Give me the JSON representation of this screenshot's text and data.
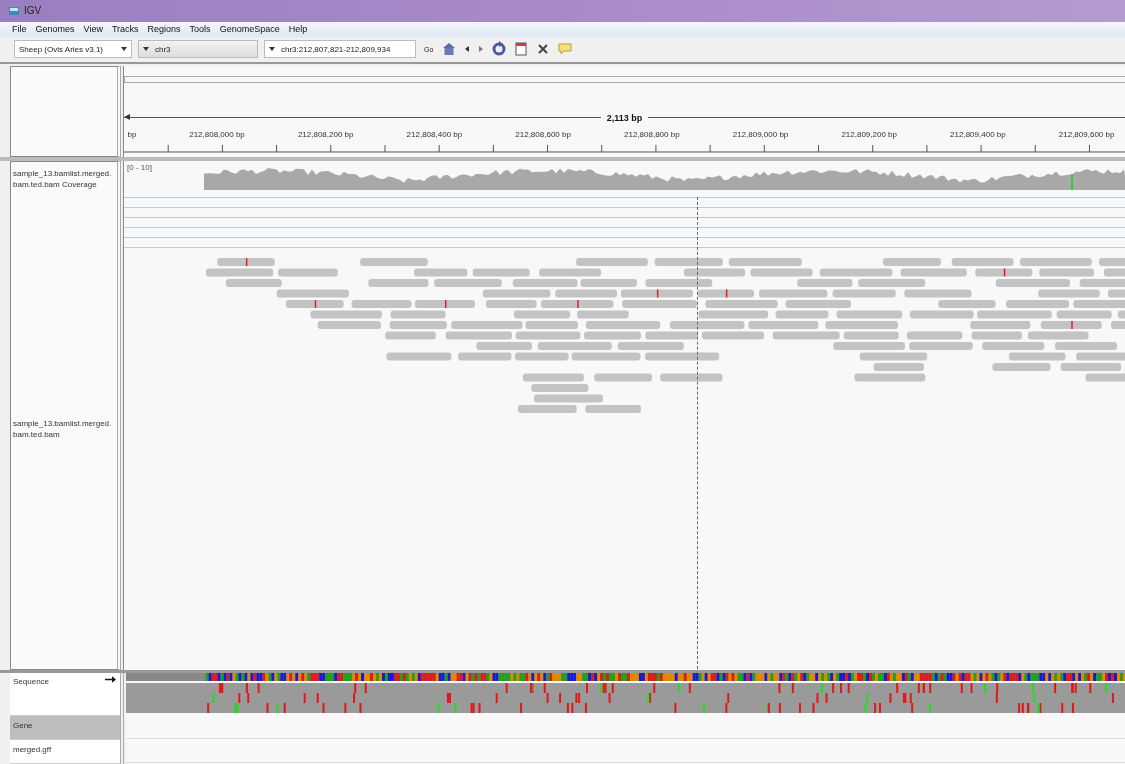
{
  "window": {
    "title": "IGV"
  },
  "menu": [
    "File",
    "Genomes",
    "View",
    "Tracks",
    "Regions",
    "Tools",
    "GenomeSpace",
    "Help"
  ],
  "toolbar": {
    "genome": "Sheep (Ovis Aries v3.1)",
    "chromosome": "chr3",
    "locus": "chr3:212,807,821-212,809,934",
    "go": "Go"
  },
  "ruler": {
    "span": "2,113 bp",
    "unit": "bp",
    "ticks": [
      "212,808,000 bp",
      "212,808,200 bp",
      "212,808,400 bp",
      "212,808,600 bp",
      "212,808,800 bp",
      "212,809,000 bp",
      "212,809,200 bp",
      "212,809,400 bp",
      "212,809,600 bp"
    ]
  },
  "tracks": {
    "coverage": {
      "name": "sample_13.bamlist.merged.bam.ted.bam Coverage",
      "range": "[0 - 10]"
    },
    "alignments": {
      "name": "sample_13.bamlist.merged.bam.ted.bam"
    }
  },
  "bottom_tracks": [
    {
      "name": "Sequence",
      "kind": "sequence",
      "selected": false
    },
    {
      "name": "Gene",
      "kind": "gene",
      "selected": true
    },
    {
      "name": "merged.gff",
      "kind": "feature",
      "selected": false
    }
  ]
}
